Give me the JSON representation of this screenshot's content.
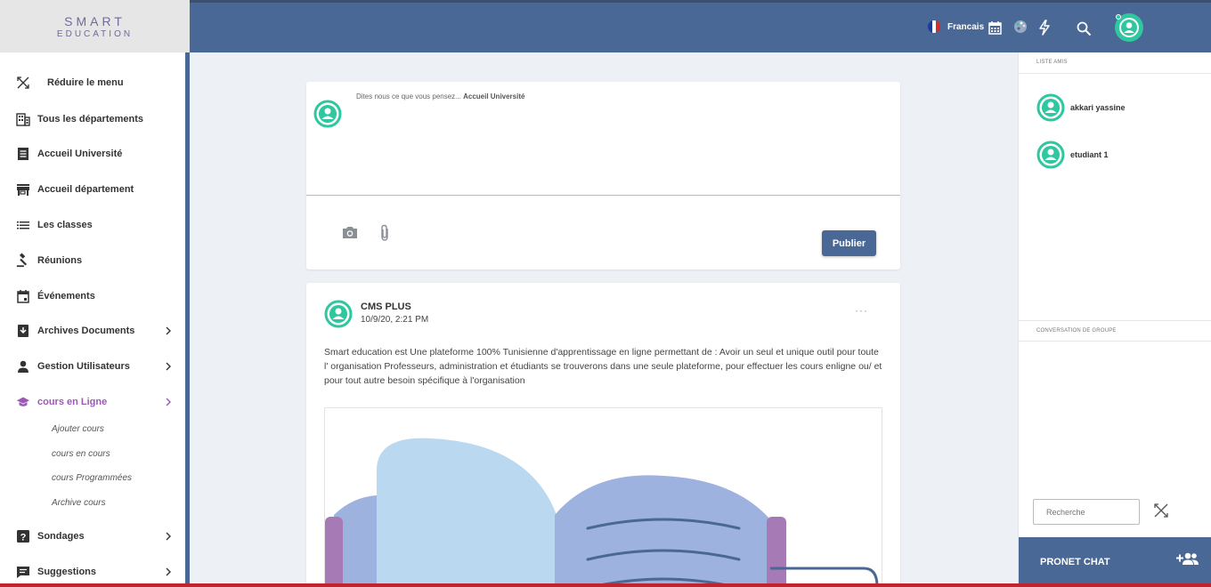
{
  "brand": {
    "line1": "SMART",
    "line2": "EDUCATION"
  },
  "header": {
    "language": "Francais",
    "icons": [
      "france-flag-icon",
      "calendar-icon",
      "palette-icon",
      "flash-icon",
      "search-icon",
      "user-avatar-icon"
    ]
  },
  "sidebar": {
    "items": [
      {
        "label": "Réduire le menu",
        "icon": "collapse-icon"
      },
      {
        "label": "Tous les départements",
        "icon": "building-icon"
      },
      {
        "label": "Accueil Université",
        "icon": "document-icon"
      },
      {
        "label": "Accueil département",
        "icon": "store-icon"
      },
      {
        "label": "Les classes",
        "icon": "list-icon"
      },
      {
        "label": "Réunions",
        "icon": "gavel-icon"
      },
      {
        "label": "Événements",
        "icon": "event-icon"
      },
      {
        "label": "Archives Documents",
        "icon": "archive-icon"
      },
      {
        "label": "Gestion Utilisateurs",
        "icon": "person-icon"
      },
      {
        "label": "cours en Ligne",
        "icon": "graduation-cap-icon"
      },
      {
        "label": "Sondages",
        "icon": "help-box-icon"
      },
      {
        "label": "Suggestions",
        "icon": "chat-bubble-icon"
      }
    ],
    "subitems": [
      "Ajouter cours",
      "cours en cours",
      "cours Programmées",
      "Archive cours"
    ]
  },
  "composer": {
    "placeholder_prefix": "Dites nous ce que vous pensez...",
    "placeholder_target": "Accueil Université",
    "publish_label": "Publier"
  },
  "post": {
    "author": "CMS PLUS",
    "date": "10/9/20, 2:21 PM",
    "more": "···",
    "body": "Smart education est Une plateforme 100% Tunisienne d'apprentissage en ligne permettant de : Avoir un seul et unique outil pour toute l' organisation Professeurs, administration et étudiants se trouverons dans une seule plateforme, pour effectuer les cours enligne ou/ et pour tout autre besoin spécifique à l'organisation"
  },
  "right_panel": {
    "friends_title": "LISTE AMIS",
    "friends": [
      {
        "name": "akkari yassine"
      },
      {
        "name": "etudiant 1"
      }
    ],
    "group_title": "CONVERSATION DE GROUPE",
    "search_placeholder": "Recherche",
    "chat_title": "PRONET CHAT"
  },
  "colors": {
    "primary": "#4a6895",
    "avatar": "#2ec7a0",
    "active": "#9b59b6",
    "bottom_bar": "#c0242e"
  }
}
